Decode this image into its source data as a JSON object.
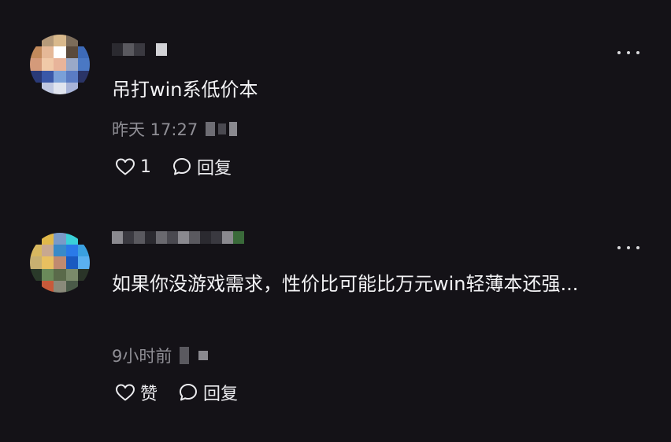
{
  "comments": [
    {
      "text": "吊打win系低价本",
      "time": "昨天 17:27",
      "like_label": "1",
      "reply_label": "回复",
      "avatar_colors": [
        "#141217",
        "#b59a7a",
        "#d9b98c",
        "#7c6c5a",
        "#141217",
        "#c28a5c",
        "#e5b897",
        "#ffffff",
        "#5a4a3c",
        "#3d6ab8",
        "#d49a7a",
        "#f0c9a8",
        "#e8b49a",
        "#9aa9c8",
        "#4a78c4",
        "#2a3a78",
        "#3a58a8",
        "#7aa0d8",
        "#5a7cc4",
        "#2a3466",
        "#141217",
        "#c0c8e0",
        "#e0e4ee",
        "#a8b4d8",
        "#141217"
      ],
      "username_colors": [
        "#2b2a30",
        "#5a595f",
        "#3a3940",
        "#141217",
        "#d2d2d6"
      ]
    },
    {
      "text": "如果你没游戏需求，性价比可能比万元win轻薄本还强...",
      "time": "9小时前",
      "like_label": "赞",
      "reply_label": "回复",
      "avatar_colors": [
        "#141217",
        "#e0b84a",
        "#7a9ac8",
        "#3ad0d8",
        "#141217",
        "#d8b860",
        "#c8a890",
        "#3a8ac8",
        "#2a7ae8",
        "#3aa0e0",
        "#c8b070",
        "#e8c060",
        "#c08a70",
        "#1a5ac0",
        "#5ab0f0",
        "#2a3a2a",
        "#6a8a5a",
        "#5a6a4a",
        "#7a8a6a",
        "#2a3428",
        "#141217",
        "#c85a3a",
        "#8a8a7a",
        "#4a5a48",
        "#141217"
      ],
      "username_colors": [
        "#8a898f",
        "#3a3940",
        "#5a595f",
        "#2b2a30",
        "#6a696f",
        "#4a4950",
        "#8a898f",
        "#5a595f",
        "#2b2a30",
        "#3a3940",
        "#8a898f",
        "#3a6a3a"
      ]
    }
  ],
  "icons": {
    "more": "more-dots-icon",
    "like": "heart-outline-icon",
    "reply": "speech-bubble-icon"
  }
}
